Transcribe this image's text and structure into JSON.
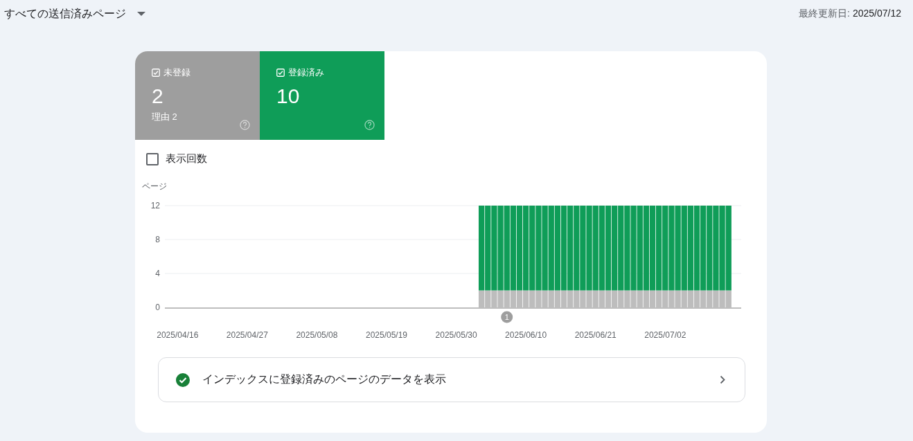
{
  "header": {
    "dropdown": "すべての送信済みページ",
    "updated_label": "最終更新日:",
    "updated_value": "2025/07/12"
  },
  "tiles": [
    {
      "label": "未登録",
      "value": "2",
      "sub": "理由 2",
      "checked": true,
      "color": "#9e9e9e"
    },
    {
      "label": "登録済み",
      "value": "10",
      "checked": true,
      "color": "#0f9d58"
    }
  ],
  "impressions": {
    "label": "表示回数",
    "checked": false
  },
  "chart": {
    "chart_data": {
      "type": "bar",
      "stacked": true,
      "ylabel": "ページ",
      "ylim": [
        0,
        12
      ],
      "yticks": [
        0,
        4,
        8,
        12
      ],
      "categories": [
        "2025/04/16",
        null,
        null,
        null,
        null,
        null,
        null,
        null,
        null,
        null,
        null,
        "2025/04/27",
        null,
        null,
        null,
        null,
        null,
        null,
        null,
        null,
        null,
        null,
        "2025/05/08",
        null,
        null,
        null,
        null,
        null,
        null,
        null,
        null,
        null,
        null,
        "2025/05/19",
        null,
        null,
        null,
        null,
        null,
        null,
        null,
        null,
        null,
        null,
        "2025/05/30",
        null,
        null,
        null,
        null,
        null,
        null,
        null,
        null,
        null,
        null,
        "2025/06/10",
        null,
        null,
        null,
        null,
        null,
        null,
        null,
        null,
        null,
        null,
        "2025/06/21",
        null,
        null,
        null,
        null,
        null,
        null,
        null,
        null,
        null,
        null,
        "2025/07/02",
        null,
        null,
        null,
        null,
        null,
        null,
        null,
        null,
        null,
        null
      ],
      "series": [
        {
          "color": "#bdbdbd",
          "values": [
            null,
            null,
            null,
            null,
            null,
            null,
            null,
            null,
            null,
            null,
            null,
            null,
            null,
            null,
            null,
            null,
            null,
            null,
            null,
            null,
            null,
            null,
            null,
            null,
            null,
            null,
            null,
            null,
            null,
            null,
            null,
            null,
            null,
            null,
            null,
            null,
            null,
            null,
            null,
            null,
            null,
            null,
            null,
            null,
            null,
            null,
            null,
            null,
            2,
            2,
            2,
            2,
            2,
            2,
            2,
            2,
            2,
            2,
            2,
            2,
            2,
            2,
            2,
            2,
            2,
            2,
            2,
            2,
            2,
            2,
            2,
            2,
            2,
            2,
            2,
            2,
            2,
            2,
            2,
            2,
            2,
            2,
            2,
            2,
            2,
            2,
            2,
            2
          ]
        },
        {
          "color": "#0f9d58",
          "values": [
            null,
            null,
            null,
            null,
            null,
            null,
            null,
            null,
            null,
            null,
            null,
            null,
            null,
            null,
            null,
            null,
            null,
            null,
            null,
            null,
            null,
            null,
            null,
            null,
            null,
            null,
            null,
            null,
            null,
            null,
            null,
            null,
            null,
            null,
            null,
            null,
            null,
            null,
            null,
            null,
            null,
            null,
            null,
            null,
            null,
            null,
            null,
            null,
            10,
            10,
            10,
            10,
            10,
            10,
            10,
            10,
            10,
            10,
            10,
            10,
            10,
            10,
            10,
            10,
            10,
            10,
            10,
            10,
            10,
            10,
            10,
            10,
            10,
            10,
            10,
            10,
            10,
            10,
            10,
            10,
            10,
            10,
            10,
            10,
            10,
            10,
            10,
            10
          ]
        }
      ],
      "annotations": [
        "1"
      ]
    }
  },
  "link_row": {
    "text": "インデックスに登録済みのページのデータを表示"
  }
}
